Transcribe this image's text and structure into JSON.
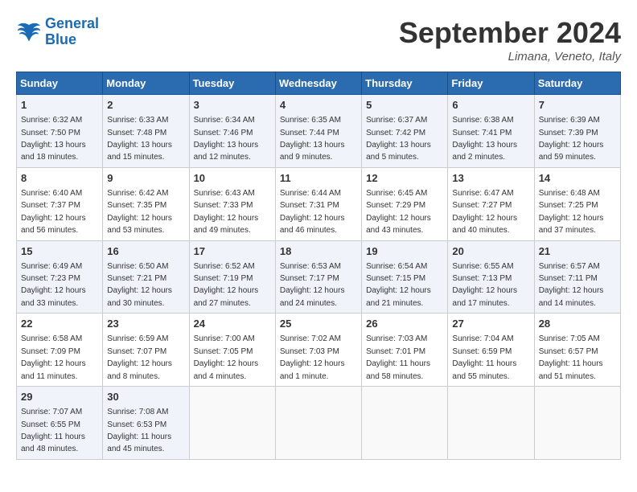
{
  "header": {
    "logo_general": "General",
    "logo_blue": "Blue",
    "month_title": "September 2024",
    "location": "Limana, Veneto, Italy"
  },
  "weekdays": [
    "Sunday",
    "Monday",
    "Tuesday",
    "Wednesday",
    "Thursday",
    "Friday",
    "Saturday"
  ],
  "weeks": [
    [
      {
        "day": "1",
        "sunrise": "6:32 AM",
        "sunset": "7:50 PM",
        "daylight": "13 hours and 18 minutes."
      },
      {
        "day": "2",
        "sunrise": "6:33 AM",
        "sunset": "7:48 PM",
        "daylight": "13 hours and 15 minutes."
      },
      {
        "day": "3",
        "sunrise": "6:34 AM",
        "sunset": "7:46 PM",
        "daylight": "13 hours and 12 minutes."
      },
      {
        "day": "4",
        "sunrise": "6:35 AM",
        "sunset": "7:44 PM",
        "daylight": "13 hours and 9 minutes."
      },
      {
        "day": "5",
        "sunrise": "6:37 AM",
        "sunset": "7:42 PM",
        "daylight": "13 hours and 5 minutes."
      },
      {
        "day": "6",
        "sunrise": "6:38 AM",
        "sunset": "7:41 PM",
        "daylight": "13 hours and 2 minutes."
      },
      {
        "day": "7",
        "sunrise": "6:39 AM",
        "sunset": "7:39 PM",
        "daylight": "12 hours and 59 minutes."
      }
    ],
    [
      {
        "day": "8",
        "sunrise": "6:40 AM",
        "sunset": "7:37 PM",
        "daylight": "12 hours and 56 minutes."
      },
      {
        "day": "9",
        "sunrise": "6:42 AM",
        "sunset": "7:35 PM",
        "daylight": "12 hours and 53 minutes."
      },
      {
        "day": "10",
        "sunrise": "6:43 AM",
        "sunset": "7:33 PM",
        "daylight": "12 hours and 49 minutes."
      },
      {
        "day": "11",
        "sunrise": "6:44 AM",
        "sunset": "7:31 PM",
        "daylight": "12 hours and 46 minutes."
      },
      {
        "day": "12",
        "sunrise": "6:45 AM",
        "sunset": "7:29 PM",
        "daylight": "12 hours and 43 minutes."
      },
      {
        "day": "13",
        "sunrise": "6:47 AM",
        "sunset": "7:27 PM",
        "daylight": "12 hours and 40 minutes."
      },
      {
        "day": "14",
        "sunrise": "6:48 AM",
        "sunset": "7:25 PM",
        "daylight": "12 hours and 37 minutes."
      }
    ],
    [
      {
        "day": "15",
        "sunrise": "6:49 AM",
        "sunset": "7:23 PM",
        "daylight": "12 hours and 33 minutes."
      },
      {
        "day": "16",
        "sunrise": "6:50 AM",
        "sunset": "7:21 PM",
        "daylight": "12 hours and 30 minutes."
      },
      {
        "day": "17",
        "sunrise": "6:52 AM",
        "sunset": "7:19 PM",
        "daylight": "12 hours and 27 minutes."
      },
      {
        "day": "18",
        "sunrise": "6:53 AM",
        "sunset": "7:17 PM",
        "daylight": "12 hours and 24 minutes."
      },
      {
        "day": "19",
        "sunrise": "6:54 AM",
        "sunset": "7:15 PM",
        "daylight": "12 hours and 21 minutes."
      },
      {
        "day": "20",
        "sunrise": "6:55 AM",
        "sunset": "7:13 PM",
        "daylight": "12 hours and 17 minutes."
      },
      {
        "day": "21",
        "sunrise": "6:57 AM",
        "sunset": "7:11 PM",
        "daylight": "12 hours and 14 minutes."
      }
    ],
    [
      {
        "day": "22",
        "sunrise": "6:58 AM",
        "sunset": "7:09 PM",
        "daylight": "12 hours and 11 minutes."
      },
      {
        "day": "23",
        "sunrise": "6:59 AM",
        "sunset": "7:07 PM",
        "daylight": "12 hours and 8 minutes."
      },
      {
        "day": "24",
        "sunrise": "7:00 AM",
        "sunset": "7:05 PM",
        "daylight": "12 hours and 4 minutes."
      },
      {
        "day": "25",
        "sunrise": "7:02 AM",
        "sunset": "7:03 PM",
        "daylight": "12 hours and 1 minute."
      },
      {
        "day": "26",
        "sunrise": "7:03 AM",
        "sunset": "7:01 PM",
        "daylight": "11 hours and 58 minutes."
      },
      {
        "day": "27",
        "sunrise": "7:04 AM",
        "sunset": "6:59 PM",
        "daylight": "11 hours and 55 minutes."
      },
      {
        "day": "28",
        "sunrise": "7:05 AM",
        "sunset": "6:57 PM",
        "daylight": "11 hours and 51 minutes."
      }
    ],
    [
      {
        "day": "29",
        "sunrise": "7:07 AM",
        "sunset": "6:55 PM",
        "daylight": "11 hours and 48 minutes."
      },
      {
        "day": "30",
        "sunrise": "7:08 AM",
        "sunset": "6:53 PM",
        "daylight": "11 hours and 45 minutes."
      },
      null,
      null,
      null,
      null,
      null
    ]
  ]
}
